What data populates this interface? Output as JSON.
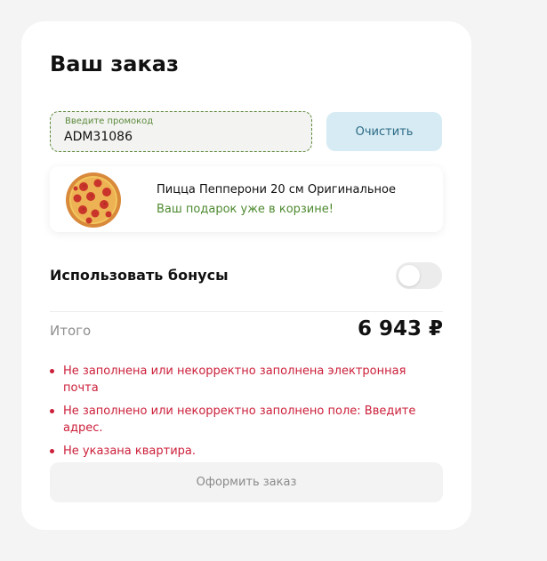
{
  "order": {
    "title": "Ваш заказ"
  },
  "promo": {
    "label": "Введите промокод",
    "value": "ADM31086",
    "clear_label": "Очистить"
  },
  "gift": {
    "icon": "pepperoni-pizza-icon",
    "name": "Пицца Пепперони 20 см Оригинальное",
    "note": "Ваш подарок уже в корзине!"
  },
  "bonus": {
    "label": "Использовать бонусы",
    "enabled": false
  },
  "total": {
    "label": "Итого",
    "value": "6 943 ₽"
  },
  "errors": [
    "Не заполнена или некорректно заполнена электронная почта",
    "Не заполнено или некорректно заполнено поле: Введите адрес.",
    "Не указана квартира."
  ],
  "submit": {
    "label": "Оформить заказ"
  },
  "colors": {
    "accent_green": "#5c8a3c",
    "error_red": "#cc1f3a",
    "clear_button_bg": "#d6ebf3"
  }
}
